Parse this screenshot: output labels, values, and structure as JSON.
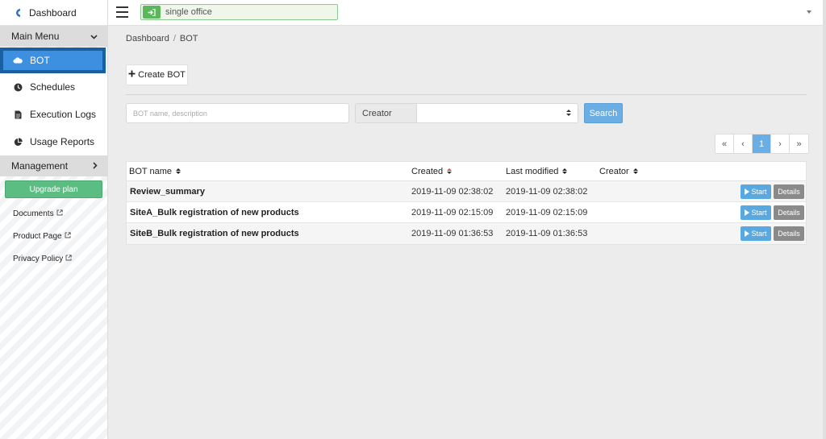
{
  "sidebar": {
    "brand": "Dashboard",
    "main_menu": "Main Menu",
    "items": [
      {
        "label": "BOT",
        "icon": "cloud-icon"
      },
      {
        "label": "Schedules",
        "icon": "clock-icon"
      },
      {
        "label": "Execution Logs",
        "icon": "file-icon"
      },
      {
        "label": "Usage Reports",
        "icon": "pie-chart-icon"
      }
    ],
    "management": "Management",
    "upgrade": "Upgrade plan",
    "links": [
      {
        "label": "Documents"
      },
      {
        "label": "Product Page"
      },
      {
        "label": "Privacy Policy"
      }
    ]
  },
  "topbar": {
    "office": "single office"
  },
  "breadcrumb": {
    "home": "Dashboard",
    "sep": "/",
    "current": "BOT"
  },
  "toolbar": {
    "create_label": "Create BOT",
    "search_placeholder": "BOT name, description",
    "creator_label": "Creator",
    "search_label": "Search"
  },
  "pager": {
    "first": "«",
    "prev": "‹",
    "page": "1",
    "next": "›",
    "last": "»"
  },
  "table": {
    "headers": {
      "name": "BOT name",
      "created": "Created",
      "modified": "Last modified",
      "creator": "Creator"
    },
    "rows": [
      {
        "name": "Review_summary",
        "created": "2019-11-09 02:38:02",
        "modified": "2019-11-09 02:38:02",
        "creator": ""
      },
      {
        "name": "SiteA_Bulk registration of new products",
        "created": "2019-11-09 02:15:09",
        "modified": "2019-11-09 02:15:09",
        "creator": ""
      },
      {
        "name": "SiteB_Bulk registration of new products",
        "created": "2019-11-09 01:36:53",
        "modified": "2019-11-09 01:36:53",
        "creator": ""
      }
    ],
    "start_label": "Start",
    "details_label": "Details"
  },
  "colors": {
    "active_blue": "#3d8fe0",
    "active_border": "#1b5fa3",
    "upgrade_green": "#5bbd82",
    "search_blue": "#6aaee4",
    "details_gray": "#8a8a8a"
  }
}
